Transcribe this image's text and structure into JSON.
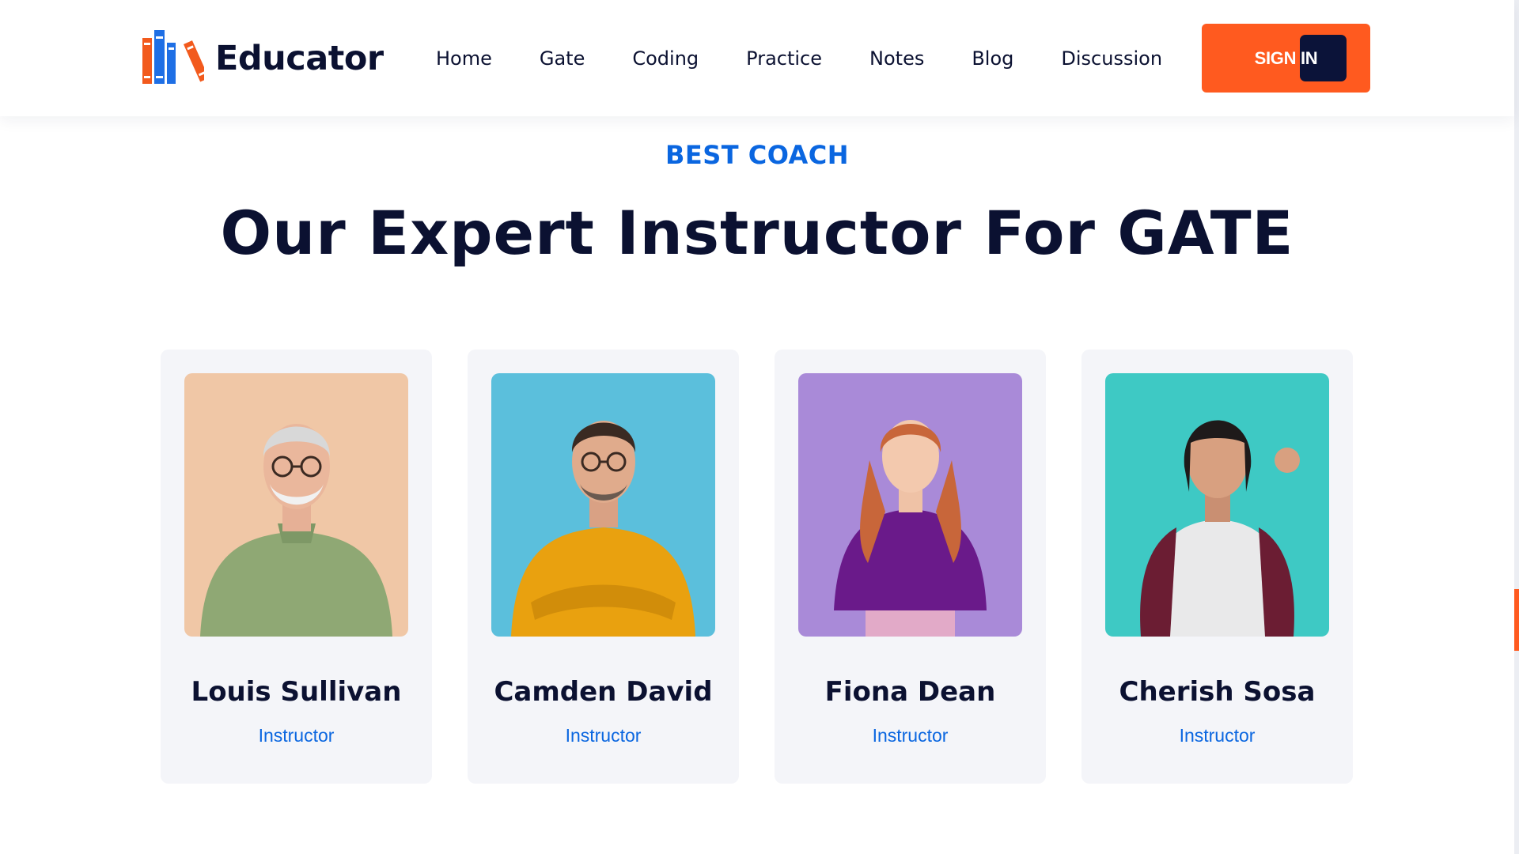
{
  "header": {
    "logo_text": "Educator",
    "nav": [
      {
        "label": "Home"
      },
      {
        "label": "Gate"
      },
      {
        "label": "Coding"
      },
      {
        "label": "Practice"
      },
      {
        "label": "Notes"
      },
      {
        "label": "Blog"
      },
      {
        "label": "Discussion"
      }
    ],
    "signin_label": "SIGN IN"
  },
  "section": {
    "eyebrow": "BEST COACH",
    "title": "Our Expert Instructor For GATE"
  },
  "instructors": [
    {
      "name": "Louis Sullivan",
      "role": "Instructor",
      "photo_bg": "#f0c7a6"
    },
    {
      "name": "Camden David",
      "role": "Instructor",
      "photo_bg": "#5bbfdc"
    },
    {
      "name": "Fiona Dean",
      "role": "Instructor",
      "photo_bg": "#a98ad8"
    },
    {
      "name": "Cherish Sosa",
      "role": "Instructor",
      "photo_bg": "#3ec9c4"
    }
  ],
  "colors": {
    "accent": "#ff5a1f",
    "primary_blue": "#0a66e0",
    "navy": "#0b1131",
    "card_bg": "#f4f5f9"
  }
}
